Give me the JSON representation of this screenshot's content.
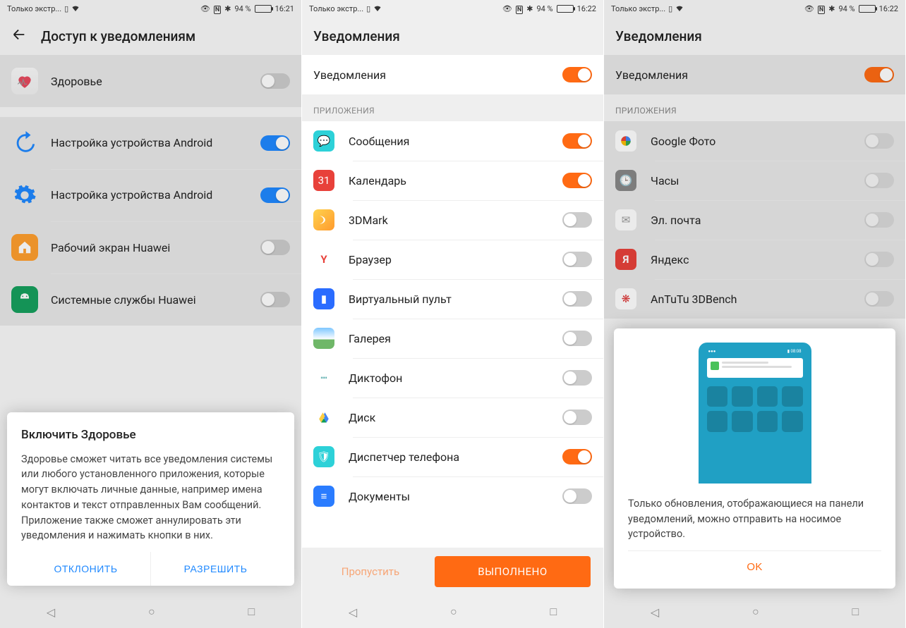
{
  "status": {
    "carrier": "Только экстр...",
    "battery_pct": "94 %",
    "t1": "16:21",
    "t2": "16:22",
    "t3": "16:22"
  },
  "p1": {
    "title": "Доступ к уведомлениям",
    "items": [
      {
        "label": "Здоровье",
        "on": false
      },
      {
        "label": "Настройка устройства Android",
        "on": true
      },
      {
        "label": "Настройка устройства Android",
        "on": true
      },
      {
        "label": "Рабочий экран Huawei",
        "on": false
      },
      {
        "label": "Системные службы Huawei",
        "on": false
      }
    ],
    "dialog": {
      "title": "Включить Здоровье",
      "body": "Здоровье сможет читать все уведомления системы или любого установленного приложения, которые могут включать личные данные, например имена контактов и текст отправленных Вам сообщений. Приложение также сможет аннулировать эти уведомления и нажимать кнопки в них.",
      "deny": "ОТКЛОНИТЬ",
      "allow": "РАЗРЕШИТЬ"
    }
  },
  "p2": {
    "title": "Уведомления",
    "master": "Уведомления",
    "section": "ПРИЛОЖЕНИЯ",
    "apps": [
      {
        "label": "Сообщения",
        "on": true
      },
      {
        "label": "Календарь",
        "on": true
      },
      {
        "label": "3DMark",
        "on": false
      },
      {
        "label": "Браузер",
        "on": false
      },
      {
        "label": "Виртуальный пульт",
        "on": false
      },
      {
        "label": "Галерея",
        "on": false
      },
      {
        "label": "Диктофон",
        "on": false
      },
      {
        "label": "Диск",
        "on": false
      },
      {
        "label": "Диспетчер телефона",
        "on": true
      },
      {
        "label": "Документы",
        "on": false
      }
    ],
    "skip": "Пропустить",
    "done": "ВЫПОЛНЕНО"
  },
  "p3": {
    "title": "Уведомления",
    "master": "Уведомления",
    "section": "ПРИЛОЖЕНИЯ",
    "apps": [
      {
        "label": "Google Фото",
        "on": false
      },
      {
        "label": "Часы",
        "on": false
      },
      {
        "label": "Эл. почта",
        "on": false
      },
      {
        "label": "Яндекс",
        "on": false
      },
      {
        "label": "AnTuTu 3DBench",
        "on": false
      }
    ],
    "dialog": {
      "body": "Только обновления, отображающиеся на панели уведомлений, можно отправить на носимое устройство.",
      "ok": "OK"
    }
  }
}
